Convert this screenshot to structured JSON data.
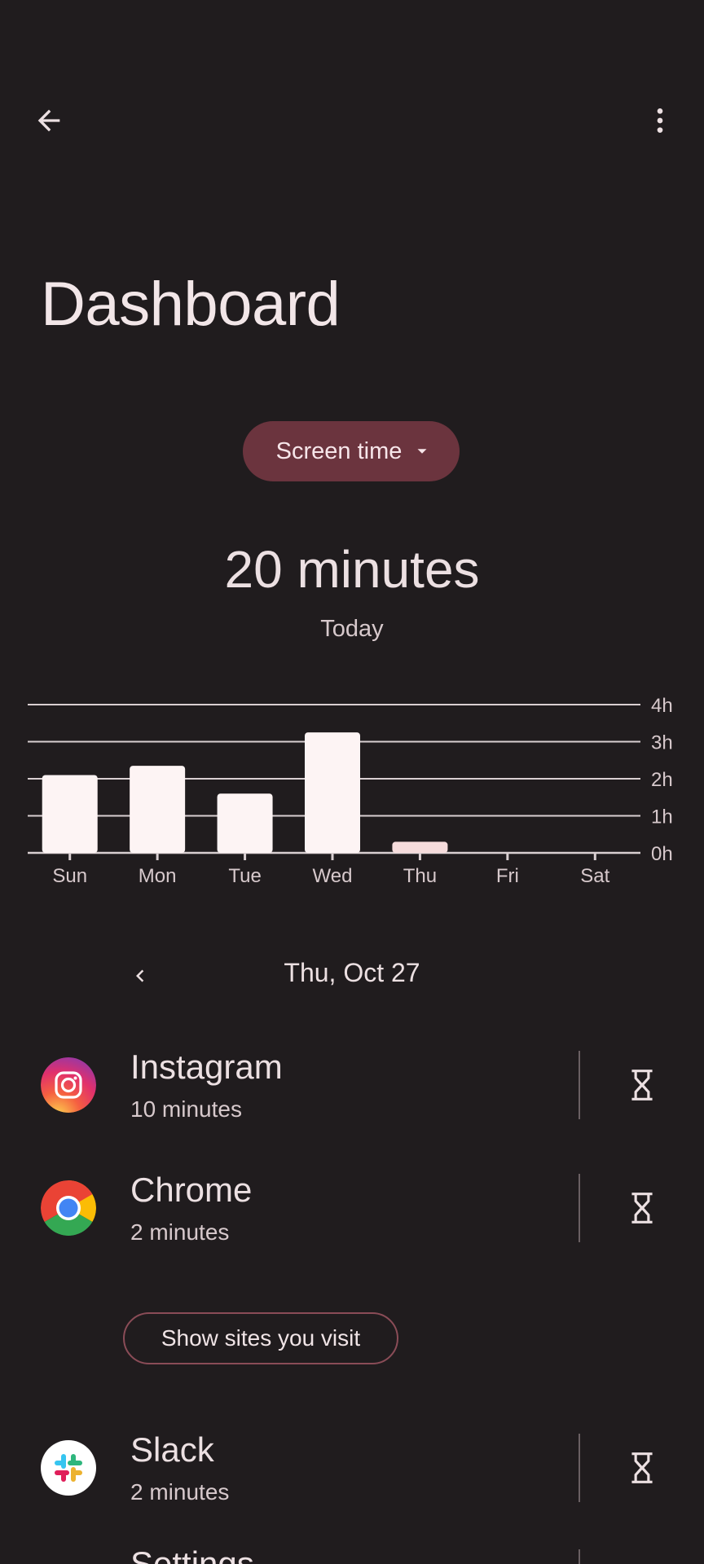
{
  "header": {
    "title": "Dashboard"
  },
  "metric_chip": {
    "label": "Screen time"
  },
  "summary": {
    "value": "20 minutes",
    "period": "Today"
  },
  "chart_data": {
    "type": "bar",
    "categories": [
      "Sun",
      "Mon",
      "Tue",
      "Wed",
      "Thu",
      "Fri",
      "Sat"
    ],
    "values": [
      2.1,
      2.35,
      1.6,
      3.25,
      0.3,
      0,
      0
    ],
    "y_ticks": [
      "0h",
      "1h",
      "2h",
      "3h",
      "4h"
    ],
    "ylim": [
      0,
      4
    ],
    "grid": true,
    "highlight_index": 4,
    "colors": {
      "bar": "#fdf4f4",
      "bar_highlight": "#f6dcdc",
      "grid": "#d9cfd1",
      "text": "#d7c9cc"
    }
  },
  "date_nav": {
    "label": "Thu, Oct 27"
  },
  "apps": [
    {
      "name": "Instagram",
      "usage": "10 minutes"
    },
    {
      "name": "Chrome",
      "usage": "2 minutes"
    },
    {
      "name": "Slack",
      "usage": "2 minutes"
    }
  ],
  "show_sites_button": "Show sites you visit",
  "cutoff_item": "Settings",
  "colors": {
    "background": "#201c1e",
    "chip": "#6b343e",
    "outline_button": "#8a4c57"
  },
  "icons": [
    "back-arrow-icon",
    "more-vert-icon",
    "dropdown-arrow-icon",
    "chevron-left-icon",
    "hourglass-icon",
    "instagram-icon",
    "chrome-icon",
    "slack-icon"
  ]
}
